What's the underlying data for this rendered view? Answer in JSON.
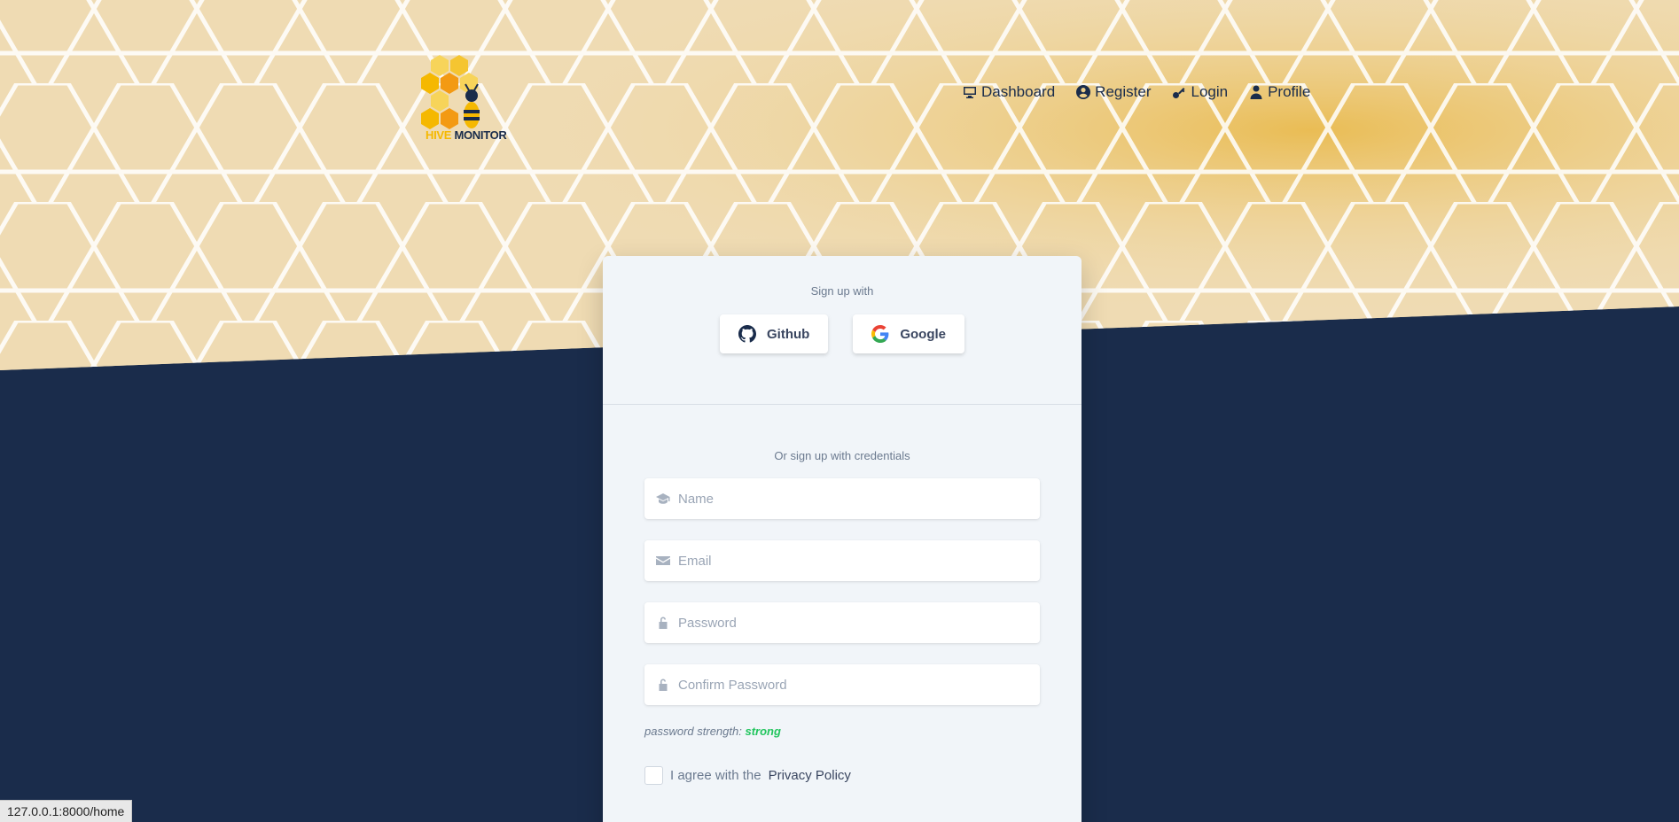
{
  "brand": {
    "word1": "HIVE",
    "word2": "MONITOR"
  },
  "nav": {
    "items": [
      {
        "label": "Dashboard",
        "icon": "monitor-icon"
      },
      {
        "label": "Register",
        "icon": "user-circle-icon"
      },
      {
        "label": "Login",
        "icon": "key-icon"
      },
      {
        "label": "Profile",
        "icon": "user-icon"
      }
    ]
  },
  "card": {
    "signup_with": "Sign up with",
    "github_label": "Github",
    "google_label": "Google",
    "or_text": "Or sign up with credentials",
    "fields": {
      "name_placeholder": "Name",
      "email_placeholder": "Email",
      "password_placeholder": "Password",
      "confirm_placeholder": "Confirm Password"
    },
    "strength_label": "password strength:",
    "strength_value": "strong",
    "agree_text": "I agree with the",
    "policy_link": "Privacy Policy"
  },
  "status_url": "127.0.0.1:8000/home",
  "colors": {
    "navy": "#1a2c4b",
    "honey": "#f5b800",
    "card_bg": "#f1f5f9",
    "strength_green": "#22c55e"
  }
}
